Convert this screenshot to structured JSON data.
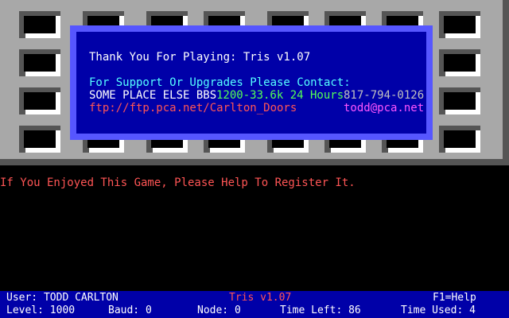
{
  "message": {
    "thanks": "Thank You For Playing: Tris v1.07",
    "support": "For Support Or Upgrades Please Contact:",
    "bbs_name": "SOME PLACE ELSE BBS",
    "bbs_speed": "1200-33.6k 24 Hours",
    "bbs_phone": "817-794-0126",
    "ftp": "ftp://ftp.pca.net/Carlton_Doors",
    "email": "todd@pca.net"
  },
  "register_prompt": "If You Enjoyed This Game, Please Help To Register It.",
  "status": {
    "user": "User: TODD CARLTON",
    "title": "Tris v1.07",
    "help": "F1=Help",
    "level": "Level: 1000",
    "baud": "Baud: 0",
    "node": "Node: 0",
    "time_left": "Time Left: 86",
    "time_used": "Time Used: 4"
  },
  "colors": {
    "panel_gray": "#a8a8a8",
    "box_blue": "#0000a8",
    "box_border": "#5656ff",
    "white": "#ffffff",
    "cyan": "#55ffff",
    "green": "#55ff55",
    "magenta": "#ff55ff",
    "red": "#ff5555"
  }
}
